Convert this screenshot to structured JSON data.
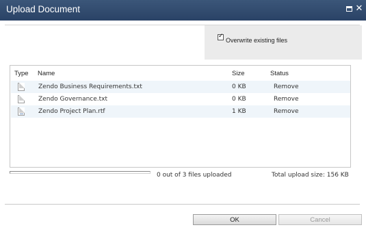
{
  "window": {
    "title": "Upload Document",
    "maximize_icon": "maximize-icon",
    "close_icon": "close-icon",
    "close_glyph": "✕"
  },
  "options": {
    "overwrite_label": "Overwrite existing files",
    "overwrite_checked": true,
    "check_glyph": "✓"
  },
  "table": {
    "columns": {
      "type": "Type",
      "name": "Name",
      "size": "Size",
      "status": "Status"
    },
    "rows": [
      {
        "icon": "text-file-icon",
        "name": "Zendo Business Requirements.txt",
        "size": "0 KB",
        "status": "Remove"
      },
      {
        "icon": "text-file-icon",
        "name": "Zendo Governance.txt",
        "size": "0 KB",
        "status": "Remove"
      },
      {
        "icon": "rtf-file-icon",
        "name": "Zendo Project Plan.rtf",
        "size": "1 KB",
        "status": "Remove"
      }
    ]
  },
  "footer": {
    "progress_text": "0 out of 3 files uploaded",
    "progress_fraction": 0,
    "total_size": "Total upload size: 156 KB"
  },
  "buttons": {
    "ok": "OK",
    "cancel": "Cancel"
  },
  "colors": {
    "titlebar": "#2f4a6f",
    "row_shade": "#eff5fa",
    "options_panel": "#ebebeb"
  }
}
